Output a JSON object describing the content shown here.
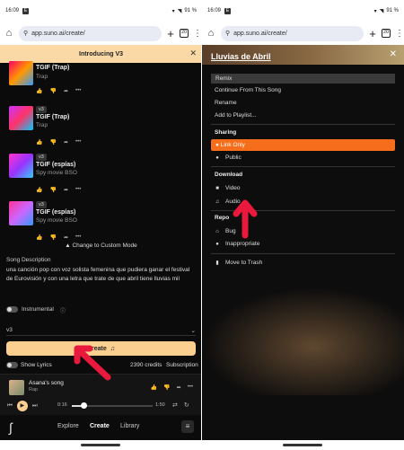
{
  "colors": {
    "banner": "#fad9a6",
    "create_button": "#fbcf90",
    "link_only": "#f66e1c",
    "arrow": "#e8193c"
  },
  "left": {
    "status": {
      "time": "16:09",
      "battery": "91 %"
    },
    "url": "app.suno.ai/create/",
    "tabs_count": "20",
    "banner": {
      "title": "Introducing V3"
    },
    "songs": [
      {
        "title": "TGIF (Trap)",
        "genre": "Trap",
        "badge": ""
      },
      {
        "title": "TGIF (Trap)",
        "genre": "Trap",
        "badge": "v3"
      },
      {
        "title": "TGIF (espías)",
        "genre": "Spy movie BSO",
        "badge": "v3"
      },
      {
        "title": "TGIF (espías)",
        "genre": "Spy movie BSO",
        "badge": "v3"
      }
    ],
    "custom_mode": "Change to Custom Mode",
    "song_description_label": "Song Description",
    "song_description": "una canción pop con voz solista femenina que pudiera ganar el festival de Eurovisión y con una letra que trate de que abril tiene lluvias mil",
    "instrumental_label": "Instrumental",
    "version": "v3",
    "create_label": "Create",
    "show_lyrics_label": "Show Lyrics",
    "credits": "2390 credits",
    "subscription": "Subscription",
    "player": {
      "title": "Asana's song",
      "genre": "Rap",
      "elapsed": "0:16",
      "duration": "1:50",
      "progress": 0.15
    },
    "nav": {
      "explore": "Explore",
      "create": "Create",
      "library": "Library"
    }
  },
  "right": {
    "status": {
      "time": "16:09",
      "battery": "91 %"
    },
    "url": "app.suno.ai/create/",
    "tabs_count": "20",
    "title": "Lluvias de Abril",
    "menu_items": [
      "Remix",
      "Continue From This Song",
      "Rename",
      "Add to Playlist..."
    ],
    "sharing_label": "Sharing",
    "sharing_options": [
      "Link Only",
      "Public"
    ],
    "download_label": "Download",
    "download_options": [
      "Video",
      "Audio"
    ],
    "report_label": "Repo",
    "report_options": [
      "Bug",
      "Inappropriate"
    ],
    "trash": "Move to Trash"
  }
}
